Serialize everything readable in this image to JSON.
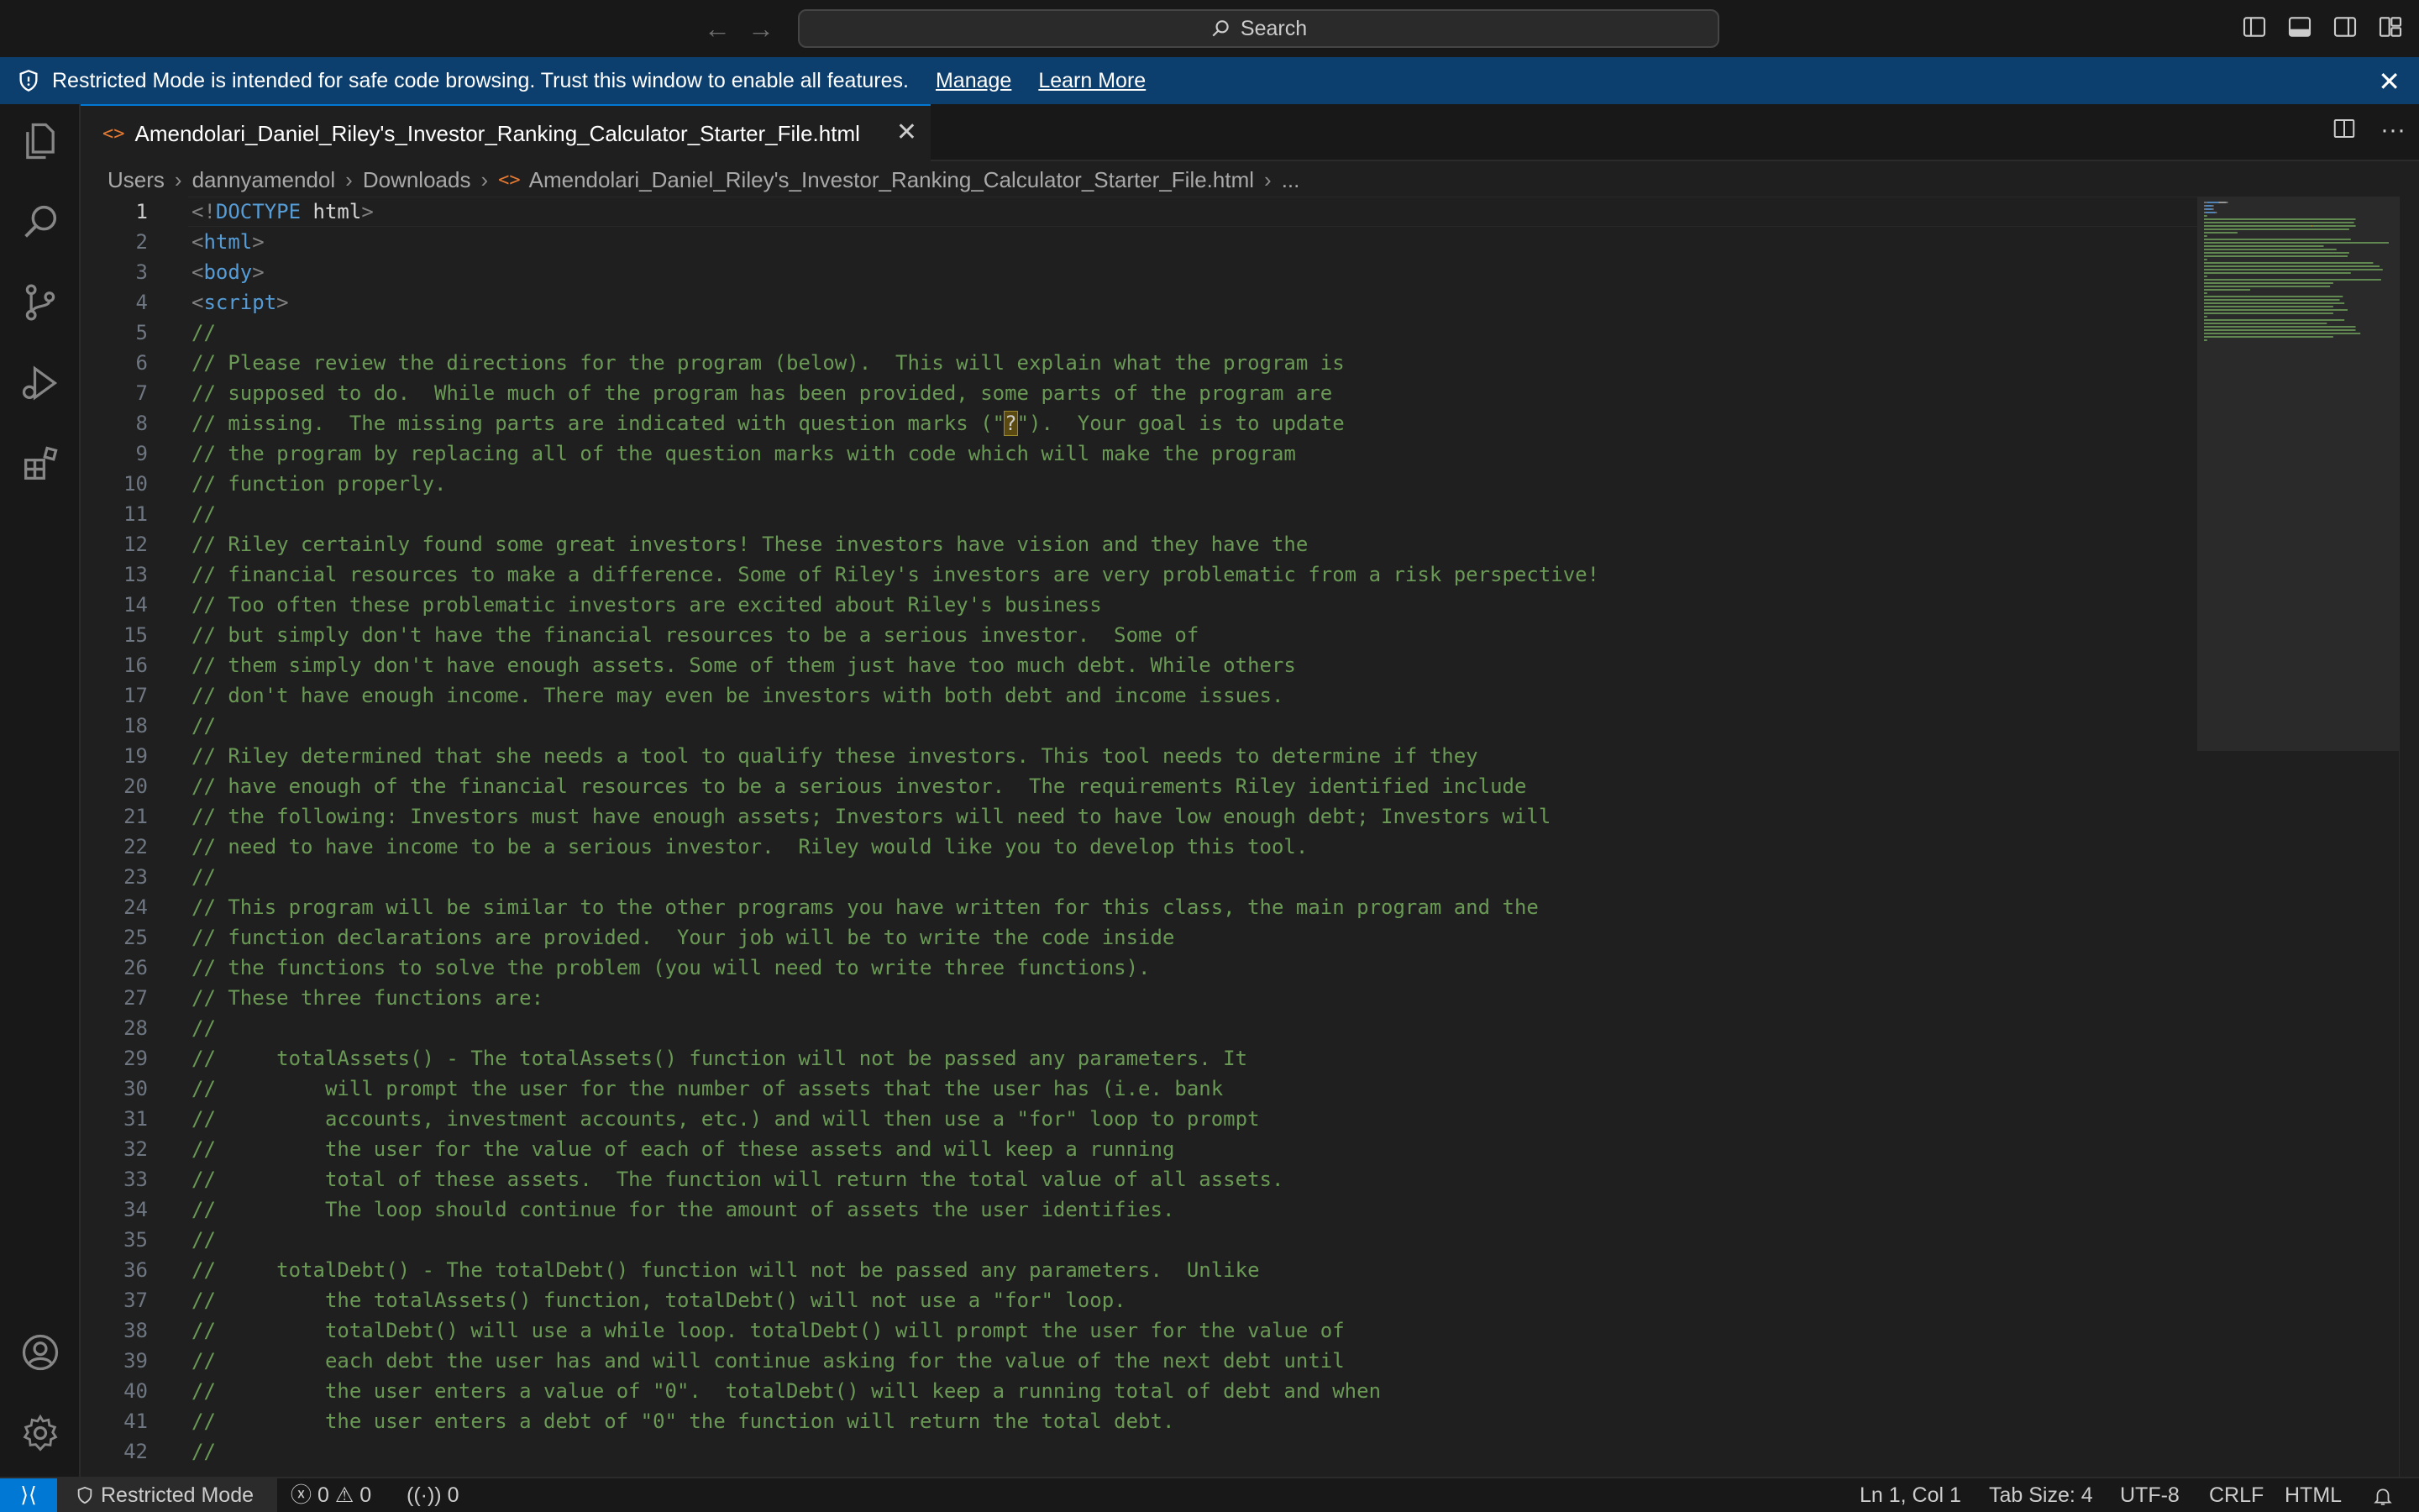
{
  "titlebar": {
    "search_label": "Search"
  },
  "banner": {
    "message": "Restricted Mode is intended for safe code browsing. Trust this window to enable all features.",
    "manage_label": "Manage",
    "learn_more_label": "Learn More"
  },
  "tab": {
    "filename": "Amendolari_Daniel_Riley's_Investor_Ranking_Calculator_Starter_File.html",
    "file_icon": "<>"
  },
  "breadcrumb": [
    "Users",
    "dannyamendol",
    "Downloads",
    "Amendolari_Daniel_Riley's_Investor_Ranking_Calculator_Starter_File.html",
    "..."
  ],
  "editor": {
    "active_line": 1,
    "lines": [
      {
        "n": "1",
        "parts": [
          [
            "tag-b",
            "<!"
          ],
          [
            "tag-n",
            "DOCTYPE"
          ],
          [
            "txt",
            " html"
          ],
          [
            "tag-b",
            ">"
          ]
        ]
      },
      {
        "n": "2",
        "parts": [
          [
            "tag-b",
            "<"
          ],
          [
            "tag-n",
            "html"
          ],
          [
            "tag-b",
            ">"
          ]
        ]
      },
      {
        "n": "3",
        "parts": [
          [
            "tag-b",
            "<"
          ],
          [
            "tag-n",
            "body"
          ],
          [
            "tag-b",
            ">"
          ]
        ]
      },
      {
        "n": "4",
        "parts": [
          [
            "tag-b",
            "<"
          ],
          [
            "tag-n",
            "script"
          ],
          [
            "tag-b",
            ">"
          ]
        ]
      },
      {
        "n": "5",
        "parts": [
          [
            "cmt",
            "//"
          ]
        ]
      },
      {
        "n": "6",
        "parts": [
          [
            "cmt",
            "// Please review the directions for the program (below).  This will explain what the program is"
          ]
        ]
      },
      {
        "n": "7",
        "parts": [
          [
            "cmt",
            "// supposed to do.  While much of the program has been provided, some parts of the program are"
          ]
        ]
      },
      {
        "n": "8",
        "parts": [
          [
            "cmt",
            "// missing.  The missing parts are indicated with question marks (\""
          ],
          [
            "hl",
            "?"
          ],
          [
            "cmt",
            "\").  Your goal is to update"
          ]
        ]
      },
      {
        "n": "9",
        "parts": [
          [
            "cmt",
            "// the program by replacing all of the question marks with code which will make the program"
          ]
        ]
      },
      {
        "n": "10",
        "parts": [
          [
            "cmt",
            "// function properly."
          ]
        ]
      },
      {
        "n": "11",
        "parts": [
          [
            "cmt",
            "//"
          ]
        ]
      },
      {
        "n": "12",
        "parts": [
          [
            "cmt",
            "// Riley certainly found some great investors! These investors have vision and they have the"
          ]
        ]
      },
      {
        "n": "13",
        "parts": [
          [
            "cmt",
            "// financial resources to make a difference. Some of Riley's investors are very problematic from a risk perspective!"
          ]
        ]
      },
      {
        "n": "14",
        "parts": [
          [
            "cmt",
            "// Too often these problematic investors are excited about Riley's business"
          ]
        ]
      },
      {
        "n": "15",
        "parts": [
          [
            "cmt",
            "// but simply don't have the financial resources to be a serious investor.  Some of"
          ]
        ]
      },
      {
        "n": "16",
        "parts": [
          [
            "cmt",
            "// them simply don't have enough assets. Some of them just have too much debt. While others"
          ]
        ]
      },
      {
        "n": "17",
        "parts": [
          [
            "cmt",
            "// don't have enough income. There may even be investors with both debt and income issues."
          ]
        ]
      },
      {
        "n": "18",
        "parts": [
          [
            "cmt",
            "//"
          ]
        ]
      },
      {
        "n": "19",
        "parts": [
          [
            "cmt",
            "// Riley determined that she needs a tool to qualify these investors. This tool needs to determine if they"
          ]
        ]
      },
      {
        "n": "20",
        "parts": [
          [
            "cmt",
            "// have enough of the financial resources to be a serious investor.  The requirements Riley identified include"
          ]
        ]
      },
      {
        "n": "21",
        "parts": [
          [
            "cmt",
            "// the following: Investors must have enough assets; Investors will need to have low enough debt; Investors will"
          ]
        ]
      },
      {
        "n": "22",
        "parts": [
          [
            "cmt",
            "// need to have income to be a serious investor.  Riley would like you to develop this tool."
          ]
        ]
      },
      {
        "n": "23",
        "parts": [
          [
            "cmt",
            "//"
          ]
        ]
      },
      {
        "n": "24",
        "parts": [
          [
            "cmt",
            "// This program will be similar to the other programs you have written for this class, the main program and the"
          ]
        ]
      },
      {
        "n": "25",
        "parts": [
          [
            "cmt",
            "// function declarations are provided.  Your job will be to write the code inside"
          ]
        ]
      },
      {
        "n": "26",
        "parts": [
          [
            "cmt",
            "// the functions to solve the problem (you will need to write three functions)."
          ]
        ]
      },
      {
        "n": "27",
        "parts": [
          [
            "cmt",
            "// These three functions are:"
          ]
        ]
      },
      {
        "n": "28",
        "parts": [
          [
            "cmt",
            "//"
          ]
        ]
      },
      {
        "n": "29",
        "parts": [
          [
            "cmt",
            "//     totalAssets() - The totalAssets() function will not be passed any parameters. It"
          ]
        ]
      },
      {
        "n": "30",
        "parts": [
          [
            "cmt",
            "//         will prompt the user for the number of assets that the user has (i.e. bank"
          ]
        ]
      },
      {
        "n": "31",
        "parts": [
          [
            "cmt",
            "//         accounts, investment accounts, etc.) and will then use a \"for\" loop to prompt"
          ]
        ]
      },
      {
        "n": "32",
        "parts": [
          [
            "cmt",
            "//         the user for the value of each of these assets and will keep a running"
          ]
        ]
      },
      {
        "n": "33",
        "parts": [
          [
            "cmt",
            "//         total of these assets.  The function will return the total value of all assets."
          ]
        ]
      },
      {
        "n": "34",
        "parts": [
          [
            "cmt",
            "//         The loop should continue for the amount of assets the user identifies."
          ]
        ]
      },
      {
        "n": "35",
        "parts": [
          [
            "cmt",
            "//"
          ]
        ]
      },
      {
        "n": "36",
        "parts": [
          [
            "cmt",
            "//     totalDebt() - The totalDebt() function will not be passed any parameters.  Unlike"
          ]
        ]
      },
      {
        "n": "37",
        "parts": [
          [
            "cmt",
            "//         the totalAssets() function, totalDebt() will not use a \"for\" loop."
          ]
        ]
      },
      {
        "n": "38",
        "parts": [
          [
            "cmt",
            "//         totalDebt() will use a while loop. totalDebt() will prompt the user for the value of"
          ]
        ]
      },
      {
        "n": "39",
        "parts": [
          [
            "cmt",
            "//         each debt the user has and will continue asking for the value of the next debt until"
          ]
        ]
      },
      {
        "n": "40",
        "parts": [
          [
            "cmt",
            "//         the user enters a value of \"0\".  totalDebt() will keep a running total of debt and when"
          ]
        ]
      },
      {
        "n": "41",
        "parts": [
          [
            "cmt",
            "//         the user enters a debt of \"0\" the function will return the total debt."
          ]
        ]
      },
      {
        "n": "42",
        "parts": [
          [
            "cmt",
            "//"
          ]
        ]
      }
    ]
  },
  "statusbar": {
    "restricted_label": "Restricted Mode",
    "errors": "0",
    "warnings": "0",
    "ports": "0",
    "position": "Ln 1, Col 1",
    "tab_size": "Tab Size: 4",
    "encoding": "UTF-8",
    "eol": "CRLF",
    "language": "HTML"
  },
  "colors": {
    "accent": "#0078d4",
    "banner": "#0c3f6e",
    "comment": "#6a9955",
    "tag": "#569cd6"
  }
}
